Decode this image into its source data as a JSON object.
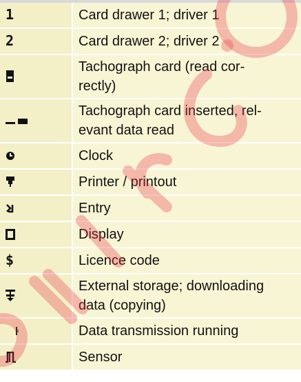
{
  "rows": [
    {
      "icon": "card-drawer-1-icon",
      "symbol": "1",
      "label": "Card drawer 1; driver 1"
    },
    {
      "icon": "card-drawer-2-icon",
      "symbol": "2",
      "label": "Card drawer 2; driver 2"
    },
    {
      "icon": "tachograph-card-icon",
      "symbol": "",
      "label": "Tachograph card (read cor-\nrectly)"
    },
    {
      "icon": "card-inserted-icon",
      "symbol": "",
      "label": "Tachograph card inserted, rel-\nevant data read"
    },
    {
      "icon": "clock-icon",
      "symbol": "",
      "label": "Clock"
    },
    {
      "icon": "printer-icon",
      "symbol": "",
      "label": "Printer / printout"
    },
    {
      "icon": "entry-icon",
      "symbol": "",
      "label": "Entry"
    },
    {
      "icon": "display-icon",
      "symbol": "",
      "label": "Display"
    },
    {
      "icon": "licence-code-icon",
      "symbol": "$",
      "label": "Licence code"
    },
    {
      "icon": "external-storage-icon",
      "symbol": "",
      "label": "External storage; downloading\ndata (copying)"
    },
    {
      "icon": "data-transmission-icon",
      "symbol": "",
      "label": "Data transmission running"
    },
    {
      "icon": "sensor-icon",
      "symbol": "",
      "label": "Sensor"
    }
  ]
}
